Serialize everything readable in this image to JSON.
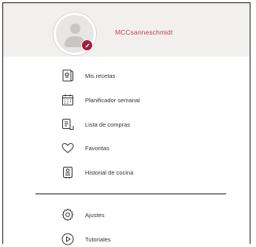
{
  "profile": {
    "username": "MCCsanneschmidt"
  },
  "menu": [
    {
      "label": "Mis recetas",
      "icon": "recipe-book-icon"
    },
    {
      "label": "Planificador semanal",
      "icon": "calendar-icon"
    },
    {
      "label": "Lista de compras",
      "icon": "shopping-list-icon"
    },
    {
      "label": "Favoritas",
      "icon": "heart-icon"
    },
    {
      "label": "Historial de cocina",
      "icon": "cooking-history-icon"
    }
  ],
  "secondary_menu": [
    {
      "label": "Ajustes",
      "icon": "gear-icon"
    },
    {
      "label": "Tutoriales",
      "icon": "play-icon"
    }
  ],
  "colors": {
    "accent": "#c04257",
    "badge": "#a51d35",
    "header_bg": "#f2f0ee"
  }
}
